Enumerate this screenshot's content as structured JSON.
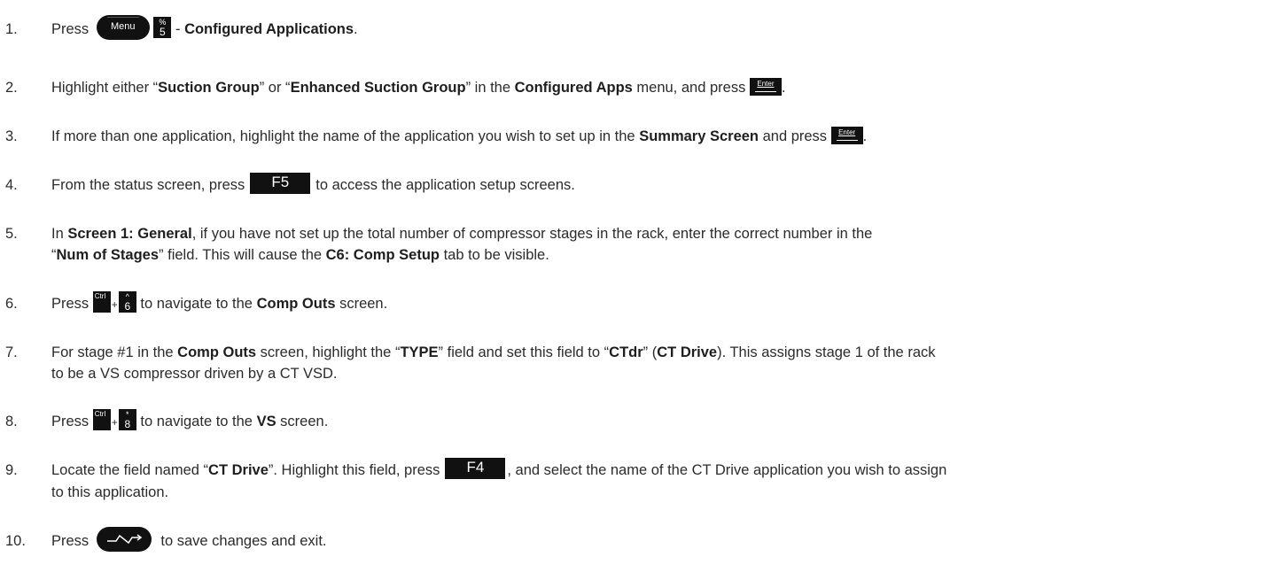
{
  "steps": [
    {
      "n": "1.",
      "press": "Press",
      "menu_key": "Menu",
      "key5_top": "%",
      "key5_bot": "5",
      "sep": "-",
      "b1": "Configured Applications",
      "end": "."
    },
    {
      "n": "2.",
      "t1": "Highlight either “",
      "b1": "Suction Group",
      "t2": "” or “",
      "b2": "Enhanced Suction Group",
      "t3": "” in the ",
      "b3": "Configured Apps",
      "t4": " menu, and press",
      "enter": "Enter",
      "end": "."
    },
    {
      "n": "3.",
      "t1": "If more than one application, highlight the name of the application you wish to set up in the ",
      "b1": "Summary Screen",
      "t2": " and press",
      "enter": "Enter",
      "end": "."
    },
    {
      "n": "4.",
      "t1": "From the status screen, press",
      "fkey": "F5",
      "t2": "to access the application setup screens."
    },
    {
      "n": "5.",
      "t1": "In ",
      "b1": "Screen 1: General",
      "t2": ", if you have not set up the total number of compressor stages in the rack, enter the correct number in the",
      "line2a": "“",
      "b2": "Num of Stages",
      "t3": "” field. This will cause the ",
      "b3": "C6: Comp Setup",
      "t4": " tab to be visible."
    },
    {
      "n": "6.",
      "press": "Press",
      "ctrl": "Ctrl",
      "plus": "+",
      "k_top": "^",
      "k_bot": "6",
      "t1": "to navigate to the ",
      "b1": "Comp Outs",
      "t2": " screen."
    },
    {
      "n": "7.",
      "t1": "For stage #1 in the ",
      "b1": "Comp Outs",
      "t2": " screen, highlight the “",
      "b2": "TYPE",
      "t3": "” field and set this field to “",
      "b3": "CTdr",
      "t4": "” (",
      "b4": "CT Drive",
      "t5": "). This assigns stage 1 of the rack",
      "line2": "to be a VS compressor driven by a CT VSD."
    },
    {
      "n": "8.",
      "press": "Press",
      "ctrl": "Ctrl",
      "plus": "+",
      "k_top": "*",
      "k_bot": "8",
      "t1": "to navigate to the ",
      "b1": "VS",
      "t2": " screen."
    },
    {
      "n": "9.",
      "t1": "Locate the field named “",
      "b1": "CT Drive",
      "t2": "”. Highlight this field, press",
      "fkey": "F4",
      "t3": ", and select the name of the CT Drive application you wish to assign",
      "line2": "to this application."
    },
    {
      "n": "10.",
      "press": "Press",
      "t1": "to save changes and exit."
    }
  ]
}
